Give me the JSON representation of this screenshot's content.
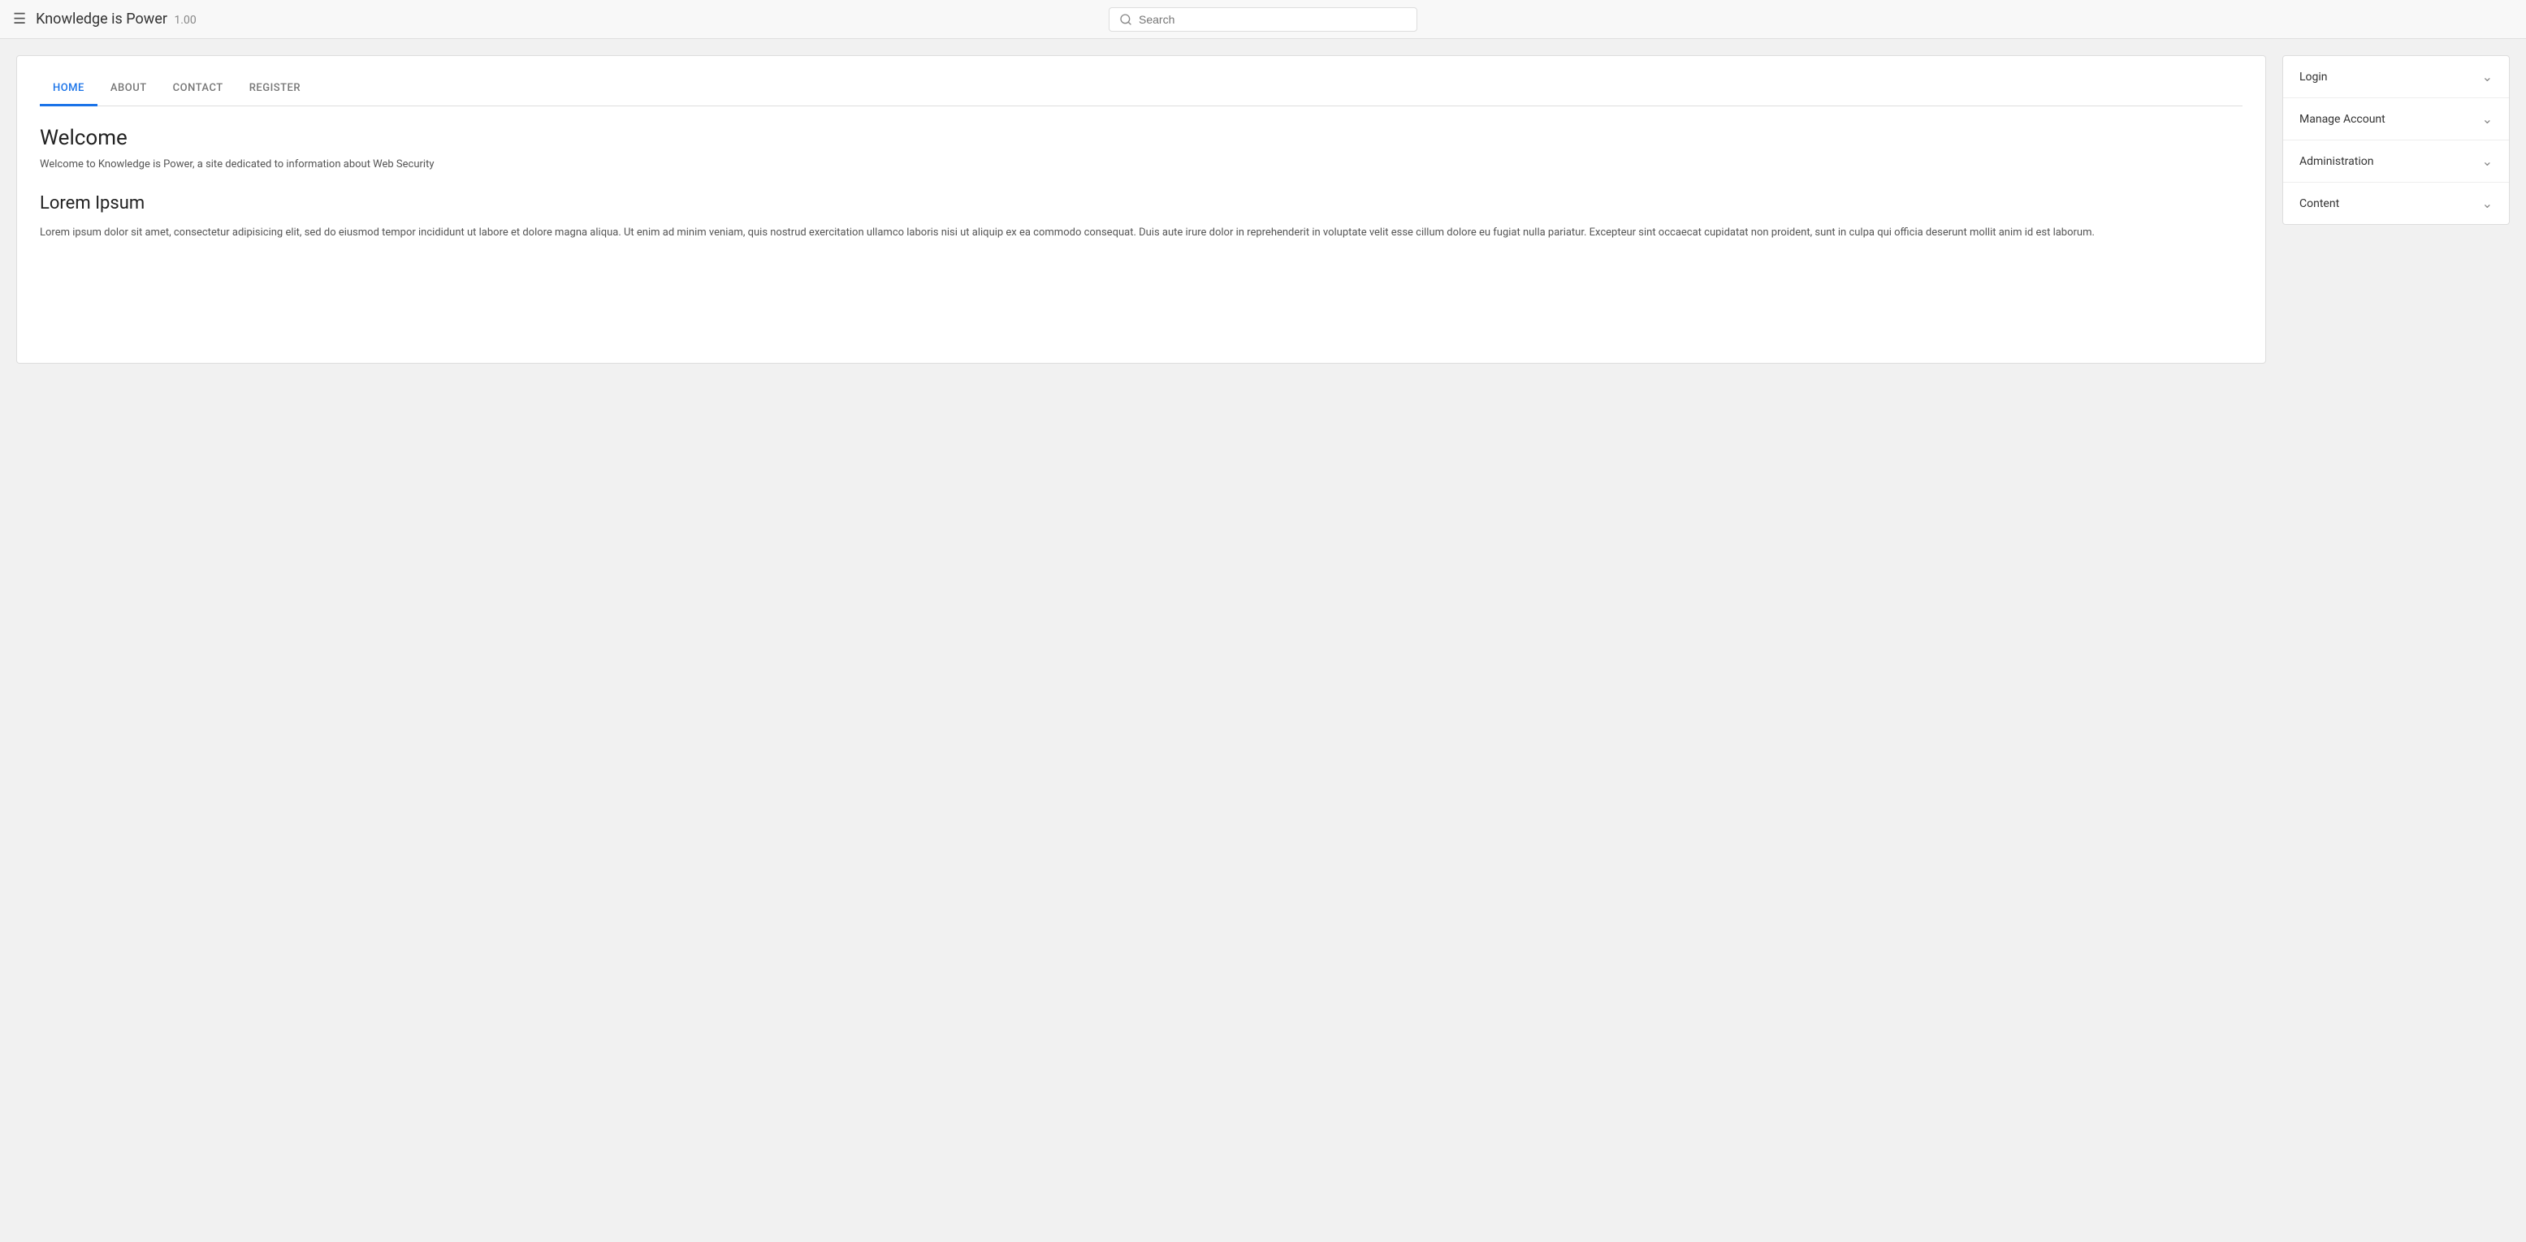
{
  "navbar": {
    "menu_icon": "☰",
    "title": "Knowledge is Power",
    "version": "1.00",
    "search_placeholder": "Search"
  },
  "tabs": [
    {
      "id": "home",
      "label": "HOME",
      "active": true
    },
    {
      "id": "about",
      "label": "ABOUT",
      "active": false
    },
    {
      "id": "contact",
      "label": "CONTACT",
      "active": false
    },
    {
      "id": "register",
      "label": "REGISTER",
      "active": false
    }
  ],
  "content": {
    "welcome_heading": "Welcome",
    "welcome_text": "Welcome to Knowledge is Power, a site dedicated to information about Web Security",
    "lorem_heading": "Lorem Ipsum",
    "lorem_body": "Lorem ipsum dolor sit amet, consectetur adipisicing elit, sed do eiusmod tempor incididunt ut labore et dolore magna aliqua. Ut enim ad minim veniam, quis nostrud exercitation ullamco laboris nisi ut aliquip ex ea commodo consequat. Duis aute irure dolor in reprehenderit in voluptate velit esse cillum dolore eu fugiat nulla pariatur. Excepteur sint occaecat cupidatat non proident, sunt in culpa qui officia deserunt mollit anim id est laborum."
  },
  "sidebar": {
    "items": [
      {
        "id": "login",
        "label": "Login"
      },
      {
        "id": "manage-account",
        "label": "Manage Account"
      },
      {
        "id": "administration",
        "label": "Administration"
      },
      {
        "id": "content",
        "label": "Content"
      }
    ]
  }
}
